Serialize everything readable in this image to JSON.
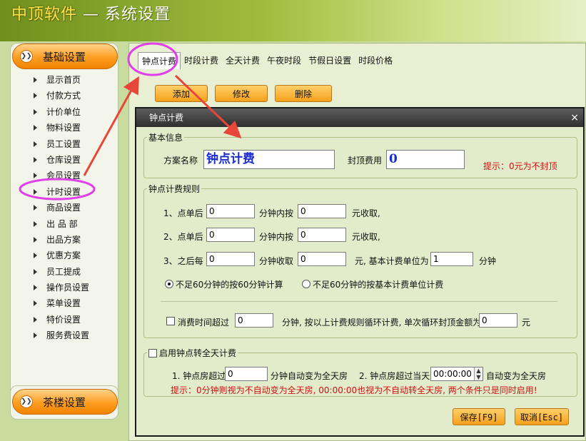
{
  "app": {
    "title_main": "中顶软件",
    "title_dash": " — ",
    "title_sub": "系统设置"
  },
  "sidebar": {
    "section_top": "基础设置",
    "items": [
      {
        "label": "显示首页"
      },
      {
        "label": "付款方式"
      },
      {
        "label": "计价单位"
      },
      {
        "label": "物料设置"
      },
      {
        "label": "员工设置"
      },
      {
        "label": "仓库设置"
      },
      {
        "label": "会员设置"
      },
      {
        "label": "计时设置"
      },
      {
        "label": "商品设置"
      },
      {
        "label": "出 品 部"
      },
      {
        "label": "出品方案"
      },
      {
        "label": "优惠方案"
      },
      {
        "label": "员工提成"
      },
      {
        "label": "操作员设置"
      },
      {
        "label": "菜单设置"
      },
      {
        "label": "特价设置"
      },
      {
        "label": "服务费设置"
      }
    ],
    "section_bottom": "茶楼设置",
    "circle_glyph": "❯❯"
  },
  "tabs": [
    {
      "label": "钟点计费"
    },
    {
      "label": "时段计费"
    },
    {
      "label": "全天计费"
    },
    {
      "label": "午夜时段"
    },
    {
      "label": "节假日设置"
    },
    {
      "label": "时段价格"
    }
  ],
  "toolbar": {
    "add": "添加",
    "edit": "修改",
    "delete": "删除"
  },
  "dialog": {
    "title": "钟点计费",
    "close_glyph": "×",
    "basic": {
      "legend": "基本信息",
      "scheme_name_label": "方案名称",
      "scheme_name_value": "钟点计费",
      "cap_label": "封顶费用",
      "cap_value": "0",
      "hint": "提示：0元为不封顶"
    },
    "rules": {
      "legend": "钟点计费规则",
      "row1": {
        "prefix": "1、点单后",
        "v1": "0",
        "mid": "分钟内按",
        "v2": "0",
        "suffix": "元收取,"
      },
      "row2": {
        "prefix": "2、点单后",
        "v1": "0",
        "mid": "分钟内按",
        "v2": "0",
        "suffix": "元收取,"
      },
      "row3": {
        "prefix": "3、之后每",
        "v1": "0",
        "mid": "分钟收取",
        "v2": "0",
        "suffix": "元, 基本计费单位为",
        "v3": "1",
        "unit": "分钟"
      },
      "radio1": "不足60分钟的按60分钟计算",
      "radio2": "不足60分钟的按基本计费单位计费",
      "loop_label": "消费时间超过",
      "loop_value1": "0",
      "loop_mid": "分钟, 按以上计费规则循环计费, 单次循环封顶金额为",
      "loop_value2": "0",
      "loop_unit": "元"
    },
    "fullday": {
      "legend": "启用钟点转全天计费",
      "item1_label": "1. 钟点房超过",
      "item1_value": "0",
      "item1_suffix": "分钟自动变为全天房",
      "item2_label": "2. 钟点房超过当天",
      "item2_value": "00:00:00",
      "item2_suffix": "自动变为全天房",
      "hint": "提示：0分钟则视为不自动变为全天房, 00:00:00也视为不自动转全天房, 两个条件只是同时启用!"
    },
    "save": "保存[F9]",
    "cancel": "取消[Esc]"
  },
  "colors": {
    "annotation": "#e040e8",
    "arrow": "#e8463a"
  }
}
